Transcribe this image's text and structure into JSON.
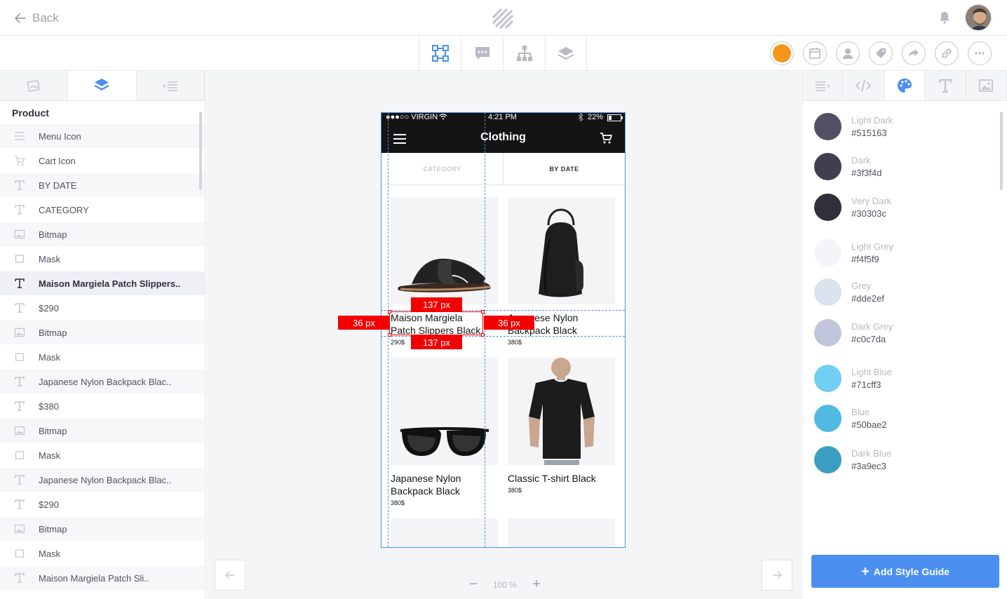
{
  "header": {
    "back_label": "Back"
  },
  "toolbar": {
    "tabs": [
      "select",
      "comments",
      "hierarchy",
      "layers"
    ],
    "circle_buttons": [
      "color",
      "calendar",
      "user",
      "tag",
      "share",
      "link",
      "more"
    ],
    "accent_color": "#f5961a"
  },
  "left_panel": {
    "group_title": "Product",
    "layers": [
      {
        "icon": "menu-icon",
        "label": "Menu Icon"
      },
      {
        "icon": "cart-icon",
        "label": "Cart Icon"
      },
      {
        "icon": "text-icon",
        "label": "BY DATE"
      },
      {
        "icon": "text-icon",
        "label": "CATEGORY"
      },
      {
        "icon": "image-icon",
        "label": "Bitmap"
      },
      {
        "icon": "mask-icon",
        "label": "Mask"
      },
      {
        "icon": "text-icon",
        "label": "Maison Margiela Patch Slippers.."
      },
      {
        "icon": "text-icon",
        "label": "$290"
      },
      {
        "icon": "image-icon",
        "label": "Bitmap"
      },
      {
        "icon": "mask-icon",
        "label": "Mask"
      },
      {
        "icon": "text-icon",
        "label": "Japanese Nylon Backpack Blac.."
      },
      {
        "icon": "text-icon",
        "label": "$380"
      },
      {
        "icon": "image-icon",
        "label": "Bitmap"
      },
      {
        "icon": "mask-icon",
        "label": "Mask"
      },
      {
        "icon": "text-icon",
        "label": "Japanese Nylon Backpack Blac.."
      },
      {
        "icon": "text-icon",
        "label": "$290"
      },
      {
        "icon": "image-icon",
        "label": "Bitmap"
      },
      {
        "icon": "mask-icon",
        "label": "Mask"
      },
      {
        "icon": "text-icon",
        "label": "Maison Margiela Patch Sli.."
      }
    ],
    "selected_index": 6
  },
  "phone": {
    "carrier": "●●●○○ VIRGIN",
    "time": "4:21 PM",
    "battery": "22%",
    "title": "Clothing",
    "tab_category": "CATEGORY",
    "tab_by_date": "BY DATE",
    "products": [
      {
        "name": "Maison Margiela Patch Slippers Black",
        "price": "290$"
      },
      {
        "name": "Japanese Nylon Backpack Black",
        "price": "380$"
      },
      {
        "name": "Japanese Nylon Backpack Black",
        "price": "380$"
      },
      {
        "name": "Classic T-shirt Black",
        "price": "380$"
      }
    ]
  },
  "measurements": {
    "top": "137 px",
    "bottom": "137 px",
    "left": "36 px",
    "right": "36 px"
  },
  "canvas": {
    "zoom": "100 %"
  },
  "right_panel": {
    "colors": [
      {
        "name": "Light Dark",
        "hex": "#515163"
      },
      {
        "name": "Dark",
        "hex": "#3f3f4d"
      },
      {
        "name": "Very Dark",
        "hex": "#30303c"
      },
      {
        "name": "Light Grey",
        "hex": "#f4f5f9"
      },
      {
        "name": "Grey",
        "hex": "#dde2ef"
      },
      {
        "name": "Dark Grey",
        "hex": "#c0c7da"
      },
      {
        "name": "Light Blue",
        "hex": "#71cff3"
      },
      {
        "name": "Blue",
        "hex": "#50bae2"
      },
      {
        "name": "Dark Blue",
        "hex": "#3a9ec3"
      }
    ],
    "add_button_label": "Add Style Guide"
  }
}
